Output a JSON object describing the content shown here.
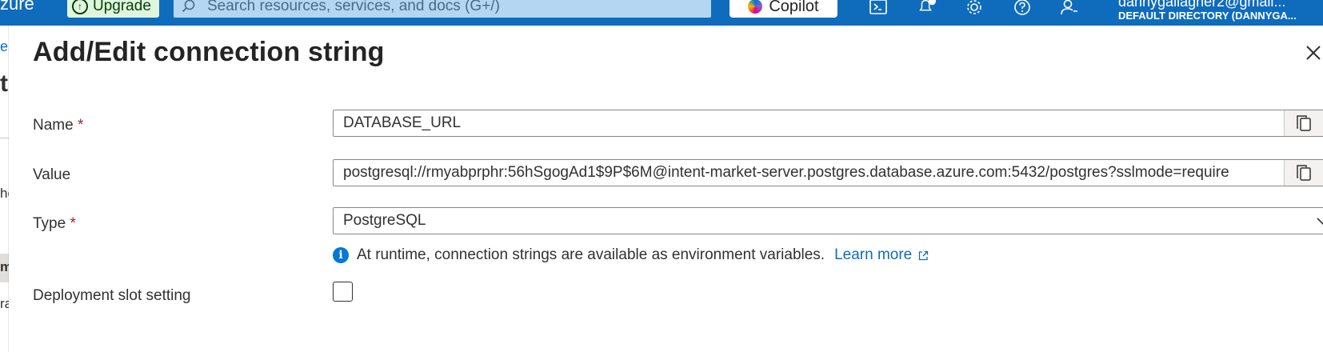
{
  "topbar": {
    "brand": "zure",
    "upgrade_label": "Upgrade",
    "search_placeholder": "Search resources, services, and docs (G+/)",
    "copilot_label": "Copilot",
    "account_email": "dannygallagher2@gmail...",
    "account_directory": "DEFAULT DIRECTORY (DANNYGA..."
  },
  "background": {
    "fragments": [
      "es",
      "t-",
      "he",
      "m",
      "ra"
    ]
  },
  "panel": {
    "title": "Add/Edit connection string",
    "name_label": "Name",
    "name_value": "DATABASE_URL",
    "value_label": "Value",
    "value_value": "postgresql://rmyabprphr:56hSgogAd1$9P$6M@intent-market-server.postgres.database.azure.com:5432/postgres?sslmode=require",
    "type_label": "Type",
    "type_value": "PostgreSQL",
    "required_marker": "*",
    "info_text": "At runtime, connection strings are available as environment variables.",
    "learn_more": "Learn more",
    "slot_label": "Deployment slot setting",
    "slot_checked": false
  },
  "icons": {
    "close": "close-icon",
    "copy": "copy-icon",
    "chevron": "chevron-down-icon",
    "info": "info-icon",
    "external": "external-link-icon"
  },
  "colors": {
    "azure_blue": "#0f6cbd",
    "link": "#0f6cbd",
    "required": "#a4262c",
    "info": "#0078d4"
  }
}
